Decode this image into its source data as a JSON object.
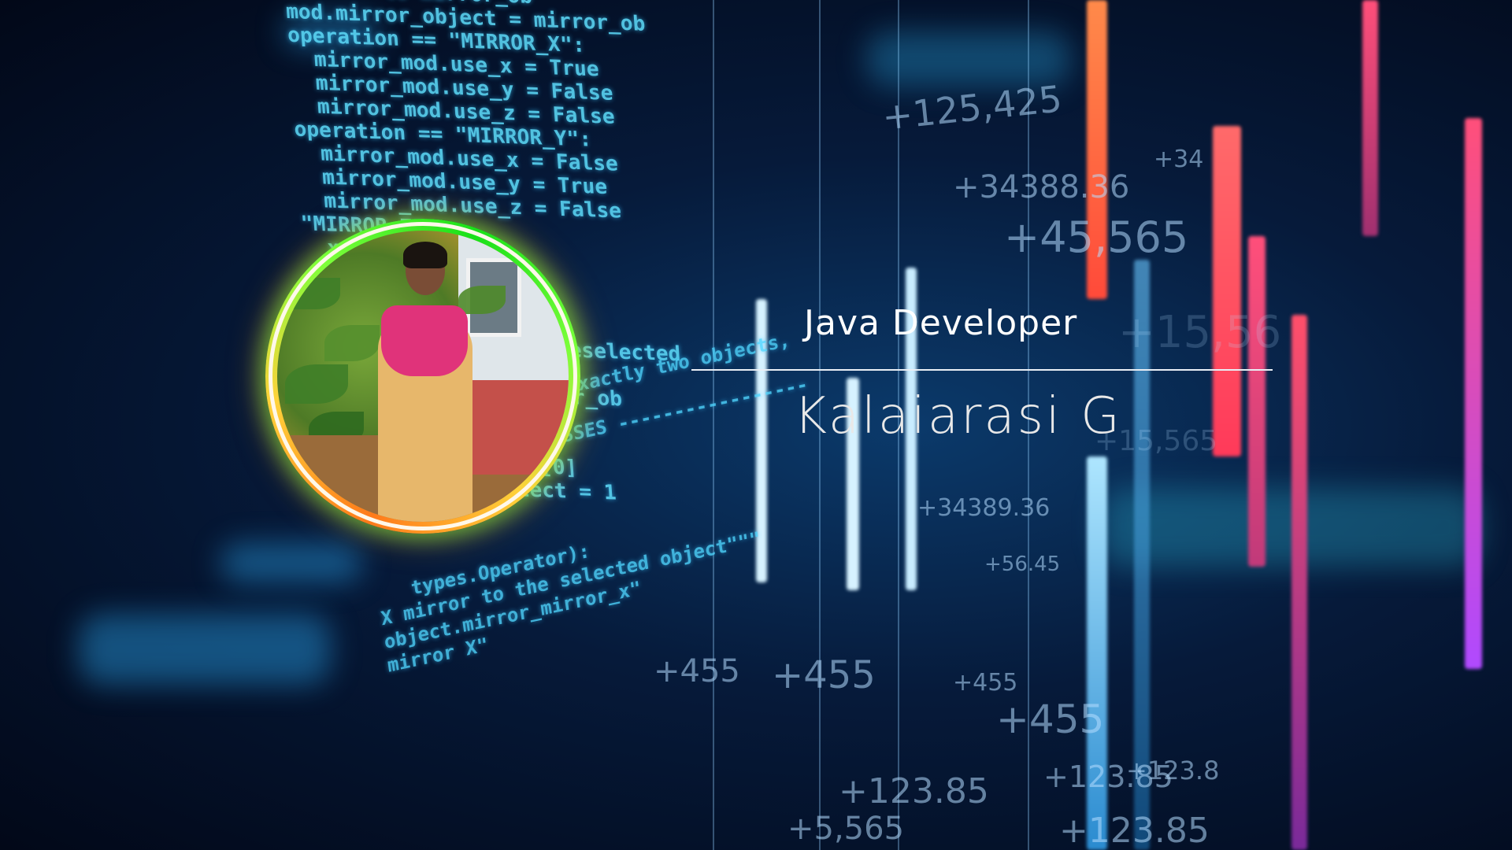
{
  "profile": {
    "job_title": "Java Developer",
    "name": "Kalaiarasi G"
  },
  "background": {
    "code_lines_top": "        to mirror_ob\nmod.mirror_object = mirror_ob\noperation == \"MIRROR_X\":\n  mirror_mod.use_x = True\n  mirror_mod.use_y = False\n  mirror_mod.use_z = False\noperation == \"MIRROR_Y\":\n  mirror_mod.use_x = False\n  mirror_mod.use_y = True\n  mirror_mod.use_z = False\n\"MIRROR_Z\":\n  x = False\n  y = False\n  z = True\n\n  end -add back the deselected\n\nects.active = modifier_ob\ntr(modifier_ob))\nct = 0\nt.selected_objects[0]\ncts[one.name].select = 1",
    "code_lines_bottom": "print(\"please select exactly two objects,\n\n        OPERATOR CLASSES -----------------\n\n\n\n\n     types.Operator):\n  X mirror to the selected object\"\"\"\n  object.mirror_mirror_x\"\n  mirror X\"",
    "numbers": [
      "+125,425",
      "+34",
      "+34388.36",
      "+45,565",
      "+15,56",
      "+45,565",
      "+34389.36",
      "+56.45",
      "+455",
      "+455",
      "+455",
      "+455",
      "+455",
      "+123.85",
      "+123.85",
      "+123.85",
      "+123.8",
      "+455",
      "+5,565",
      "+15,565"
    ],
    "accent_colors": [
      "#5fe0ff",
      "#ff5a5a",
      "#ff7a3a",
      "#c06bff",
      "#ff4f7a"
    ]
  },
  "avatar": {
    "ring_colors": [
      "#ff7a1a",
      "#ffd23a",
      "#7cff3a",
      "#19e019"
    ]
  }
}
